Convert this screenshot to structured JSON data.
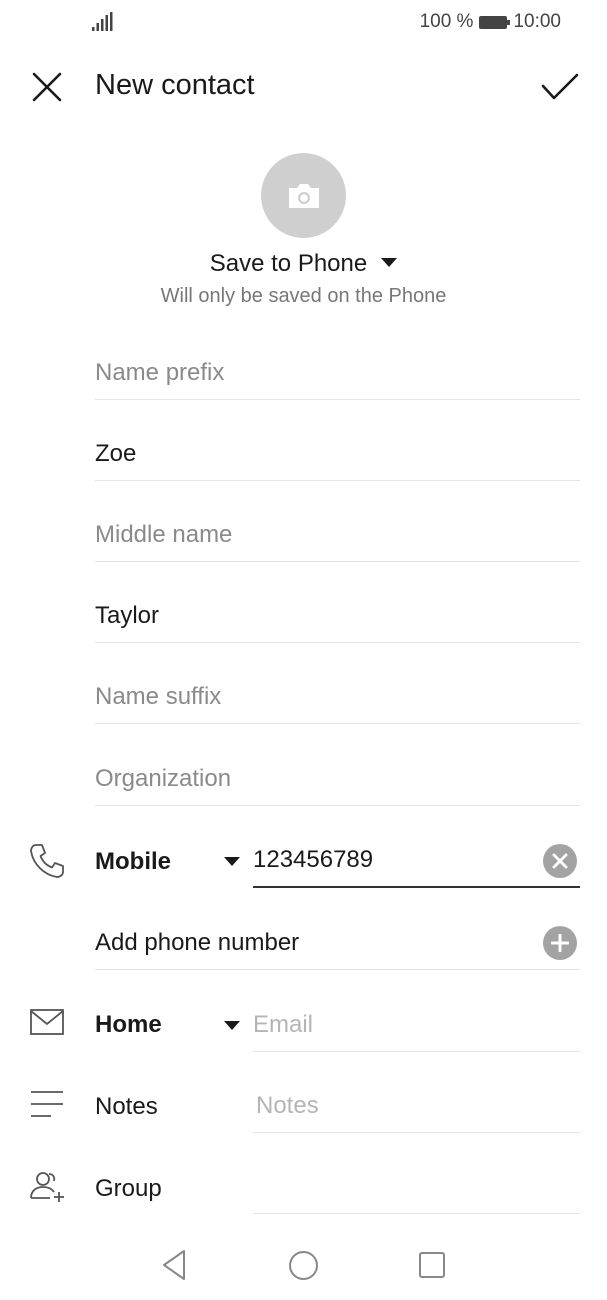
{
  "status_bar": {
    "battery_percent": "100 %",
    "time": "10:00"
  },
  "header": {
    "title": "New contact"
  },
  "account": {
    "save_to": "Save to Phone",
    "note": "Will only be saved on the Phone"
  },
  "name_fields": [
    {
      "text": "Name prefix",
      "is_placeholder": true
    },
    {
      "text": "Zoe",
      "is_placeholder": false
    },
    {
      "text": "Middle name",
      "is_placeholder": true
    },
    {
      "text": "Taylor",
      "is_placeholder": false
    },
    {
      "text": "Name suffix",
      "is_placeholder": true
    },
    {
      "text": "Organization",
      "is_placeholder": true
    }
  ],
  "phone": {
    "type_label": "Mobile",
    "value": "123456789",
    "add_label": "Add phone number"
  },
  "email": {
    "type_label": "Home",
    "placeholder": "Email"
  },
  "notes": {
    "label": "Notes",
    "placeholder": "Notes"
  },
  "group": {
    "label": "Group"
  },
  "colors": {
    "photo_bg": "#cfcfcf",
    "icon_gray": "#a3a3a3",
    "placeholder": "#8a8a8a"
  }
}
